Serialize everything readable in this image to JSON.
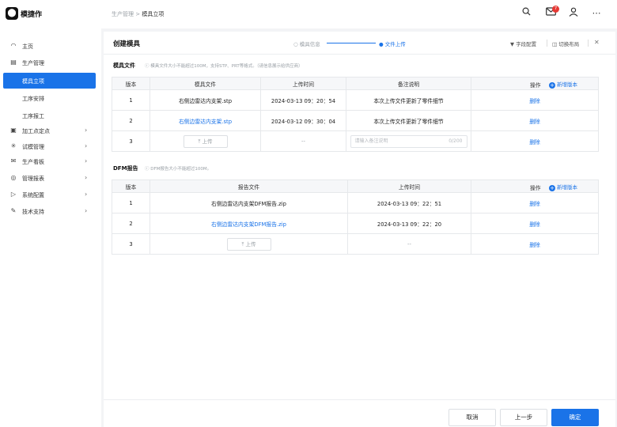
{
  "app": {
    "logo": "⬤",
    "brand": "模捷作"
  },
  "breadcrumb": {
    "parent": "生产管理",
    "sep": ">",
    "current": "模具立项"
  },
  "topbar": {
    "badge_count": "7",
    "icons": [
      "search-icon",
      "mail-icon",
      "user-icon",
      "more-icon"
    ]
  },
  "sidebar": {
    "items": [
      {
        "label": "主页",
        "icon": "dashboard-icon"
      },
      {
        "label": "生产管理",
        "icon": "factory-icon"
      },
      {
        "label": "模具立项"
      },
      {
        "label": "工序安排"
      },
      {
        "label": "工序报工"
      },
      {
        "label": "加工点定点",
        "icon": "location-icon"
      },
      {
        "label": "试模管理",
        "icon": "test-icon"
      },
      {
        "label": "生产看板",
        "icon": "board-icon"
      },
      {
        "label": "管理报表",
        "icon": "report-icon"
      },
      {
        "label": "系统配置",
        "icon": "settings-icon"
      },
      {
        "label": "技术支持",
        "icon": "support-icon"
      }
    ]
  },
  "card": {
    "title": "创建模具",
    "steps": [
      "模具信息",
      "文件上传"
    ],
    "actions": {
      "field_config": "字段配置",
      "switch_layout": "切换布局",
      "close": "✕"
    }
  },
  "mold_files": {
    "title": "模具文件",
    "hint": "模具文件大小不能超过100M，支持STP、PRT等格式。（请信息展示给供应商）",
    "columns": [
      "版本",
      "模具文件",
      "上传时间",
      "备注说明",
      "操作"
    ],
    "add_version": "新增版本",
    "rows": [
      {
        "version": "1",
        "file": "右侧边雷达内支架.stp",
        "time": "2024-03-13 09：20：54",
        "note": "本次上传文件更新了零件细节",
        "op": "删除"
      },
      {
        "version": "2",
        "file": "右侧边雷达内支架.stp",
        "time": "2024-03-12 09：30：04",
        "note": "本次上传文件更新了零件细节",
        "op": "删除"
      }
    ],
    "new_row": {
      "version": "3",
      "upload": "上传",
      "time": "--",
      "note_placeholder": "请输入备注说明",
      "note_count": "0/200",
      "op": "删除"
    }
  },
  "dfm_report": {
    "title": "DFM报告",
    "hint": "DFM报告大小不能超过100M。",
    "columns": [
      "版本",
      "报告文件",
      "上传时间",
      "操作"
    ],
    "add_version": "新增版本",
    "rows": [
      {
        "version": "1",
        "file": "右侧边雷达内支架DFM报告.zip",
        "time": "2024-03-13 09：22：51",
        "op": "删除"
      },
      {
        "version": "2",
        "file": "右侧边雷达内支架DFM报告.zip",
        "time": "2024-03-13 09：22：20",
        "op": "删除"
      }
    ],
    "new_row": {
      "version": "3",
      "upload": "上传",
      "time": "--",
      "op": "删除"
    }
  },
  "footer": {
    "cancel": "取消",
    "prev": "上一步",
    "confirm": "确定"
  }
}
